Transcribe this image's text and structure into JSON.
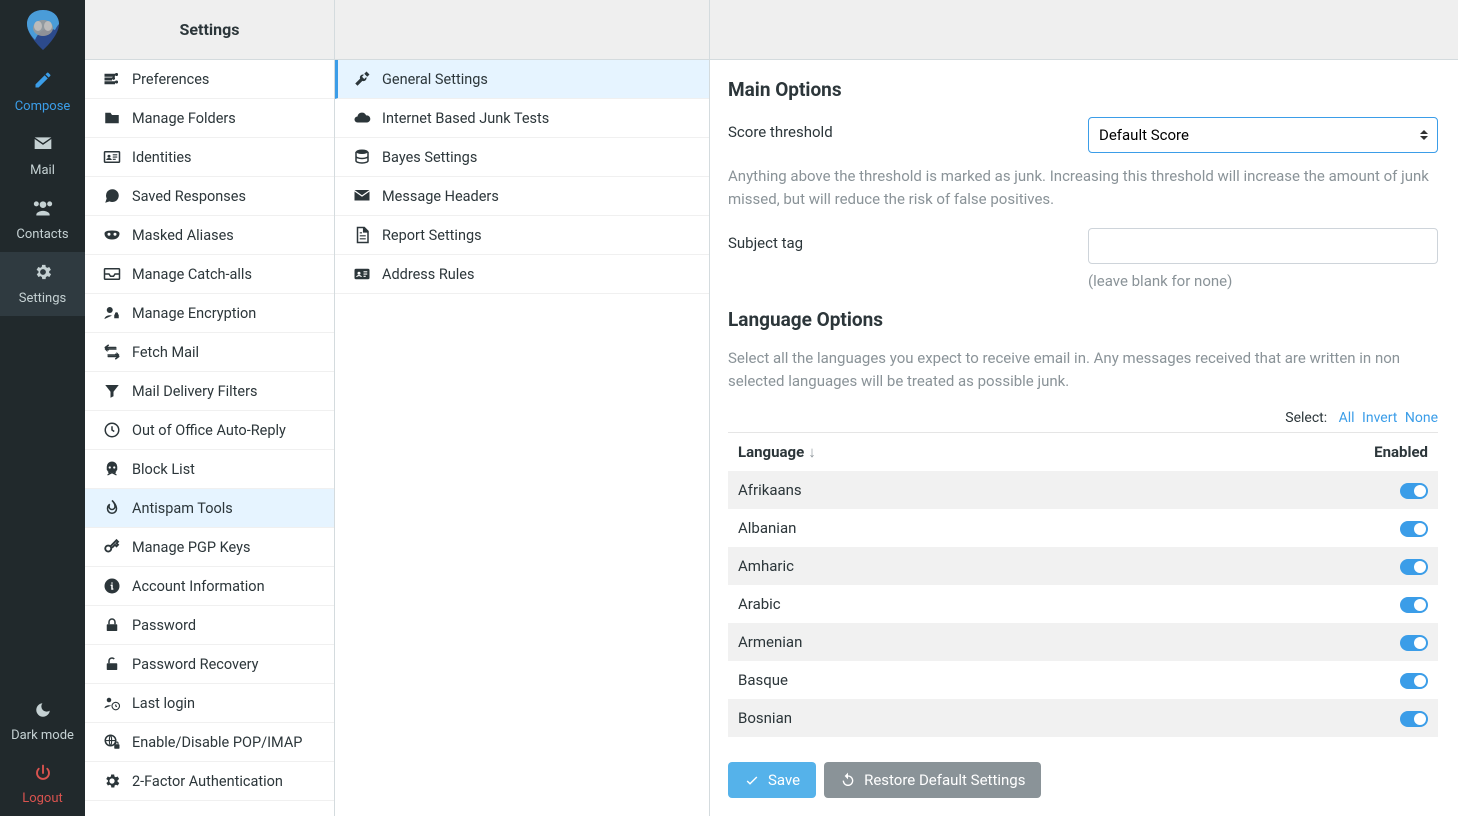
{
  "nav": {
    "compose": "Compose",
    "mail": "Mail",
    "contacts": "Contacts",
    "settings": "Settings",
    "darkmode": "Dark mode",
    "logout": "Logout"
  },
  "col_a": {
    "header": "Settings",
    "items": [
      {
        "label": "Preferences",
        "icon": "sliders"
      },
      {
        "label": "Manage Folders",
        "icon": "folder"
      },
      {
        "label": "Identities",
        "icon": "id-card"
      },
      {
        "label": "Saved Responses",
        "icon": "comment"
      },
      {
        "label": "Masked Aliases",
        "icon": "mask"
      },
      {
        "label": "Manage Catch-alls",
        "icon": "inbox"
      },
      {
        "label": "Manage Encryption",
        "icon": "user-lock"
      },
      {
        "label": "Fetch Mail",
        "icon": "exchange"
      },
      {
        "label": "Mail Delivery Filters",
        "icon": "filter"
      },
      {
        "label": "Out of Office Auto-Reply",
        "icon": "clock"
      },
      {
        "label": "Block List",
        "icon": "skull"
      },
      {
        "label": "Antispam Tools",
        "icon": "fire",
        "active": true
      },
      {
        "label": "Manage PGP Keys",
        "icon": "key"
      },
      {
        "label": "Account Information",
        "icon": "info"
      },
      {
        "label": "Password",
        "icon": "lock"
      },
      {
        "label": "Password Recovery",
        "icon": "unlock"
      },
      {
        "label": "Last login",
        "icon": "users-clock"
      },
      {
        "label": "Enable/Disable POP/IMAP",
        "icon": "globe-lock"
      },
      {
        "label": "2-Factor Authentication",
        "icon": "gear"
      }
    ]
  },
  "col_b": {
    "items": [
      {
        "label": "General Settings",
        "icon": "tools",
        "active": true
      },
      {
        "label": "Internet Based Junk Tests",
        "icon": "cloud"
      },
      {
        "label": "Bayes Settings",
        "icon": "database"
      },
      {
        "label": "Message Headers",
        "icon": "envelope"
      },
      {
        "label": "Report Settings",
        "icon": "file"
      },
      {
        "label": "Address Rules",
        "icon": "address-card"
      }
    ]
  },
  "main": {
    "section1_title": "Main Options",
    "score_label": "Score threshold",
    "score_value": "Default Score",
    "score_help": "Anything above the threshold is marked as junk. Increasing this threshold will increase the amount of junk missed, but will reduce the risk of false positives.",
    "subject_label": "Subject tag",
    "subject_value": "",
    "subject_hint": "(leave blank for none)",
    "section2_title": "Language Options",
    "lang_help": "Select all the languages you expect to receive email in. Any messages received that are written in non selected languages will be treated as possible junk.",
    "select_label": "Select:",
    "select_all": "All",
    "select_invert": "Invert",
    "select_none": "None",
    "th_language": "Language",
    "th_enabled": "Enabled",
    "languages": [
      {
        "name": "Afrikaans",
        "on": true
      },
      {
        "name": "Albanian",
        "on": true
      },
      {
        "name": "Amharic",
        "on": true
      },
      {
        "name": "Arabic",
        "on": true
      },
      {
        "name": "Armenian",
        "on": true
      },
      {
        "name": "Basque",
        "on": true
      },
      {
        "name": "Bosnian",
        "on": true
      }
    ],
    "save": "Save",
    "restore": "Restore Default Settings"
  }
}
